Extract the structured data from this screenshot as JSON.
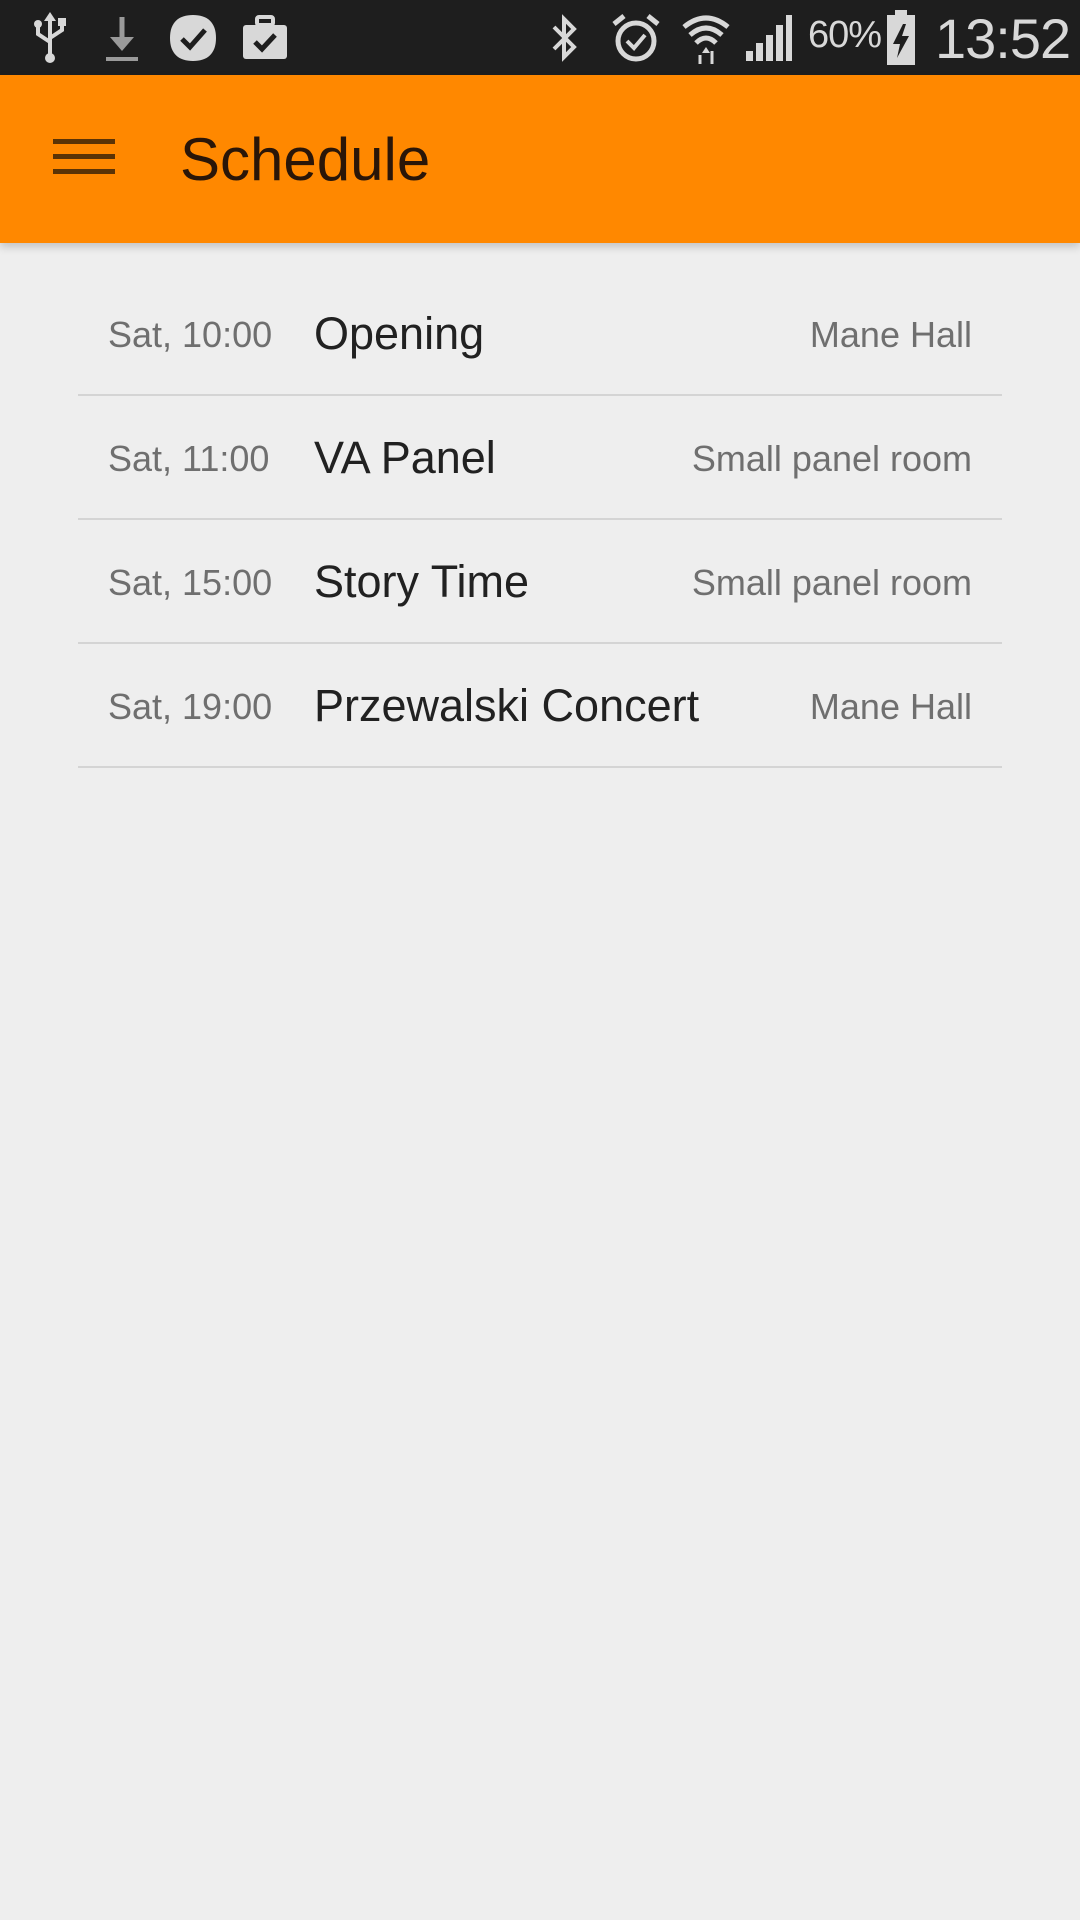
{
  "status_bar": {
    "icons": [
      "usb-icon",
      "download-icon",
      "task-check-icon",
      "briefcase-check-icon",
      "bluetooth-icon",
      "alarm-icon",
      "wifi-icon",
      "signal-icon",
      "battery-charging-icon"
    ],
    "battery_percent": "60%",
    "time": "13:52"
  },
  "app_bar": {
    "title": "Schedule",
    "menu_icon": "hamburger-menu-icon",
    "background_color": "#ff8800"
  },
  "schedule": [
    {
      "time": "Sat, 10:00",
      "title": "Opening",
      "location": "Mane Hall"
    },
    {
      "time": "Sat, 11:00",
      "title": "VA Panel",
      "location": "Small panel room"
    },
    {
      "time": "Sat, 15:00",
      "title": "Story Time",
      "location": "Small panel room"
    },
    {
      "time": "Sat, 19:00",
      "title": "Przewalski Concert",
      "location": "Mane Hall"
    }
  ]
}
